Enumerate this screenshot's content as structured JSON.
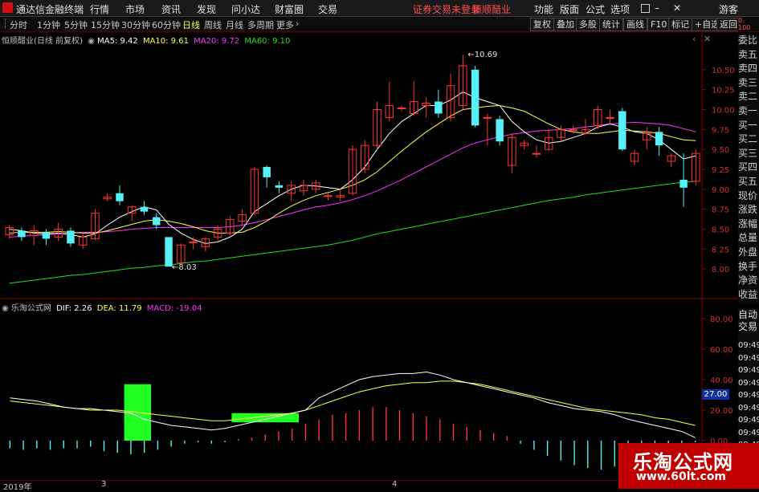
{
  "app": {
    "title": "通达信金融终端",
    "logo_icon": "app-logo-icon"
  },
  "menu": [
    {
      "label": "行情"
    },
    {
      "label": "市场"
    },
    {
      "label": "资讯"
    },
    {
      "label": "发现"
    },
    {
      "label": "问小达"
    },
    {
      "label": "财富圈"
    },
    {
      "label": "交易"
    }
  ],
  "notice": {
    "login": "证券交易未登录",
    "stock": "恒顺醋业"
  },
  "menu_right": [
    {
      "label": "功能"
    },
    {
      "label": "版面"
    },
    {
      "label": "公式"
    },
    {
      "label": "选项"
    }
  ],
  "guest": "游客",
  "periods": [
    {
      "label": "分时"
    },
    {
      "label": "1分钟"
    },
    {
      "label": "5分钟"
    },
    {
      "label": "15分钟"
    },
    {
      "label": "30分钟"
    },
    {
      "label": "60分钟"
    },
    {
      "label": "日线"
    },
    {
      "label": "周线"
    },
    {
      "label": "月线"
    },
    {
      "label": "多周期"
    },
    {
      "label": "更多"
    }
  ],
  "tools": [
    {
      "label": "复权"
    },
    {
      "label": "叠加"
    },
    {
      "label": "多股"
    },
    {
      "label": "统计"
    },
    {
      "label": "画线"
    },
    {
      "label": "F10"
    },
    {
      "label": "标记"
    },
    {
      "label": "+自选"
    },
    {
      "label": "返回"
    }
  ],
  "price_panel": {
    "title": "恒顺醋业(日线 前复权)",
    "ma": [
      {
        "label": "MA5: 9.42",
        "color": "#ffffff"
      },
      {
        "label": "MA10: 9.61",
        "color": "#ffff4a"
      },
      {
        "label": "MA20: 9.72",
        "color": "#ff33ff"
      },
      {
        "label": "MA60: 9.10",
        "color": "#22dd22"
      }
    ],
    "yticks": [
      "10.50",
      "10.25",
      "10.00",
      "9.75",
      "9.50",
      "9.25",
      "9.00",
      "8.75",
      "8.50",
      "8.25",
      "8.00"
    ],
    "high_label": "10.69",
    "low_label": "8.03"
  },
  "indicator_panel": {
    "title": "乐淘公式网",
    "dif": "DIF: 2.26",
    "dea": "DEA: 11.79",
    "macd": "MACD: -19.04",
    "yticks": [
      "80.00",
      "60.00",
      "40.00",
      "20.00",
      "0.00"
    ],
    "cursor_value": "27.00"
  },
  "dates": [
    "2019年",
    "3",
    "4"
  ],
  "right_panel": {
    "items": [
      "委比",
      "卖五",
      "卖四",
      "卖三",
      "卖二",
      "卖一",
      "买一",
      "买二",
      "买三",
      "买四",
      "买五",
      "现价",
      "涨跌",
      "涨幅",
      "总量",
      "外盘",
      "换手",
      "净资",
      "收益"
    ],
    "auto_trade": [
      "自动",
      "交易"
    ],
    "times": [
      "09:49",
      "09:49",
      "09:49",
      "09:49",
      "09:49",
      "09:49",
      "09:49",
      "09:49",
      "09:49"
    ],
    "top_mark": [
      "0.",
      "100"
    ]
  },
  "watermark": {
    "name": "乐淘公式网",
    "url": "www.60lt.com"
  },
  "colors": {
    "up": "#ff3333",
    "down": "#55f0f8",
    "ma5": "#ffffff",
    "ma10": "#ffff4a",
    "ma20": "#ff33ff",
    "ma60": "#22dd22",
    "macd_up": "#ff3333",
    "macd_down": "#55f0f8",
    "green_bar": "#22ff22"
  },
  "chart_data": [
    {
      "type": "candlestick",
      "title": "恒顺醋业(日线 前复权)",
      "ylim": [
        7.8,
        10.75
      ],
      "candles": [
        {
          "o": 8.43,
          "c": 8.52,
          "h": 8.55,
          "l": 8.38
        },
        {
          "o": 8.48,
          "c": 8.4,
          "h": 8.52,
          "l": 8.35
        },
        {
          "o": 8.42,
          "c": 8.48,
          "h": 8.55,
          "l": 8.3
        },
        {
          "o": 8.46,
          "c": 8.38,
          "h": 8.5,
          "l": 8.3
        },
        {
          "o": 8.4,
          "c": 8.5,
          "h": 8.58,
          "l": 8.35
        },
        {
          "o": 8.48,
          "c": 8.32,
          "h": 8.52,
          "l": 8.28
        },
        {
          "o": 8.3,
          "c": 8.4,
          "h": 8.45,
          "l": 8.25
        },
        {
          "o": 8.38,
          "c": 8.7,
          "h": 8.75,
          "l": 8.36
        },
        {
          "o": 8.88,
          "c": 8.9,
          "h": 8.95,
          "l": 8.85
        },
        {
          "o": 8.95,
          "c": 8.85,
          "h": 9.05,
          "l": 8.8
        },
        {
          "o": 8.7,
          "c": 8.78,
          "h": 8.8,
          "l": 8.6
        },
        {
          "o": 8.78,
          "c": 8.72,
          "h": 8.85,
          "l": 8.68
        },
        {
          "o": 8.65,
          "c": 8.55,
          "h": 8.7,
          "l": 8.5
        },
        {
          "o": 8.4,
          "c": 8.03,
          "h": 8.4,
          "l": 8.03
        },
        {
          "o": 8.08,
          "c": 8.3,
          "h": 8.32,
          "l": 8.05
        },
        {
          "o": 8.34,
          "c": 8.34,
          "h": 8.4,
          "l": 8.25
        },
        {
          "o": 8.28,
          "c": 8.38,
          "h": 8.4,
          "l": 8.22
        },
        {
          "o": 8.4,
          "c": 8.5,
          "h": 8.55,
          "l": 8.36
        },
        {
          "o": 8.45,
          "c": 8.62,
          "h": 8.66,
          "l": 8.42
        },
        {
          "o": 8.6,
          "c": 8.68,
          "h": 8.75,
          "l": 8.55
        },
        {
          "o": 8.7,
          "c": 9.25,
          "h": 9.28,
          "l": 8.68
        },
        {
          "o": 9.28,
          "c": 9.15,
          "h": 9.3,
          "l": 9.02
        },
        {
          "o": 9.05,
          "c": 9.02,
          "h": 9.1,
          "l": 8.95
        },
        {
          "o": 8.95,
          "c": 9.05,
          "h": 9.1,
          "l": 8.85
        },
        {
          "o": 8.98,
          "c": 9.05,
          "h": 9.12,
          "l": 8.92
        },
        {
          "o": 9.0,
          "c": 9.08,
          "h": 9.12,
          "l": 8.95
        },
        {
          "o": 8.92,
          "c": 8.92,
          "h": 8.95,
          "l": 8.86
        },
        {
          "o": 8.9,
          "c": 8.92,
          "h": 9.0,
          "l": 8.85
        },
        {
          "o": 8.95,
          "c": 9.5,
          "h": 9.55,
          "l": 8.92
        },
        {
          "o": 9.25,
          "c": 9.55,
          "h": 9.62,
          "l": 9.2
        },
        {
          "o": 9.55,
          "c": 10.0,
          "h": 10.1,
          "l": 9.5
        },
        {
          "o": 9.9,
          "c": 10.05,
          "h": 10.35,
          "l": 9.85
        },
        {
          "o": 10.02,
          "c": 10.02,
          "h": 10.05,
          "l": 9.98
        },
        {
          "o": 9.95,
          "c": 10.1,
          "h": 10.35,
          "l": 9.92
        },
        {
          "o": 10.05,
          "c": 10.08,
          "h": 10.15,
          "l": 9.9
        },
        {
          "o": 10.1,
          "c": 9.95,
          "h": 10.25,
          "l": 9.9
        },
        {
          "o": 9.9,
          "c": 10.3,
          "h": 10.45,
          "l": 9.85
        },
        {
          "o": 10.05,
          "c": 10.55,
          "h": 10.69,
          "l": 10.0
        },
        {
          "o": 10.5,
          "c": 9.8,
          "h": 10.55,
          "l": 9.78
        },
        {
          "o": 9.9,
          "c": 9.9,
          "h": 9.95,
          "l": 9.55
        },
        {
          "o": 9.88,
          "c": 9.6,
          "h": 9.92,
          "l": 9.55
        },
        {
          "o": 9.3,
          "c": 9.65,
          "h": 9.7,
          "l": 9.2
        },
        {
          "o": 9.55,
          "c": 9.58,
          "h": 9.62,
          "l": 9.5
        },
        {
          "o": 9.45,
          "c": 9.45,
          "h": 9.55,
          "l": 9.4
        },
        {
          "o": 9.5,
          "c": 9.65,
          "h": 9.75,
          "l": 9.48
        },
        {
          "o": 9.65,
          "c": 9.75,
          "h": 9.8,
          "l": 9.6
        },
        {
          "o": 9.75,
          "c": 9.75,
          "h": 9.8,
          "l": 9.7
        },
        {
          "o": 9.7,
          "c": 9.75,
          "h": 9.88,
          "l": 9.68
        },
        {
          "o": 9.8,
          "c": 10.0,
          "h": 10.05,
          "l": 9.75
        },
        {
          "o": 9.9,
          "c": 9.9,
          "h": 10.0,
          "l": 9.82
        },
        {
          "o": 9.98,
          "c": 9.5,
          "h": 10.02,
          "l": 9.48
        },
        {
          "o": 9.35,
          "c": 9.45,
          "h": 9.5,
          "l": 9.3
        },
        {
          "o": 9.62,
          "c": 9.7,
          "h": 9.78,
          "l": 9.5
        },
        {
          "o": 9.72,
          "c": 9.55,
          "h": 9.78,
          "l": 9.42
        },
        {
          "o": 9.35,
          "c": 9.42,
          "h": 9.45,
          "l": 9.28
        },
        {
          "o": 9.12,
          "c": 9.02,
          "h": 9.45,
          "l": 8.78
        },
        {
          "o": 9.1,
          "c": 9.45,
          "h": 9.5,
          "l": 9.05
        }
      ],
      "ma5": [
        8.5,
        8.48,
        8.45,
        8.44,
        8.45,
        8.43,
        8.4,
        8.44,
        8.55,
        8.65,
        8.72,
        8.78,
        8.74,
        8.56,
        8.45,
        8.37,
        8.32,
        8.34,
        8.4,
        8.5,
        8.72,
        8.82,
        8.92,
        9.0,
        9.05,
        9.04,
        9.02,
        9.0,
        9.12,
        9.28,
        9.5,
        9.7,
        9.85,
        9.95,
        10.05,
        10.05,
        10.12,
        10.22,
        10.15,
        10.1,
        10.05,
        9.85,
        9.72,
        9.62,
        9.58,
        9.6,
        9.65,
        9.7,
        9.78,
        9.82,
        9.78,
        9.72,
        9.7,
        9.62,
        9.5,
        9.38,
        9.42
      ],
      "ma10": [
        8.45,
        8.46,
        8.46,
        8.46,
        8.47,
        8.46,
        8.45,
        8.45,
        8.48,
        8.52,
        8.56,
        8.6,
        8.62,
        8.6,
        8.57,
        8.53,
        8.48,
        8.45,
        8.45,
        8.46,
        8.52,
        8.6,
        8.7,
        8.79,
        8.86,
        8.92,
        8.96,
        9.0,
        9.05,
        9.12,
        9.22,
        9.35,
        9.48,
        9.6,
        9.72,
        9.82,
        9.92,
        10.0,
        10.02,
        10.04,
        10.05,
        10.02,
        9.98,
        9.9,
        9.82,
        9.75,
        9.72,
        9.7,
        9.7,
        9.72,
        9.74,
        9.73,
        9.72,
        9.7,
        9.66,
        9.62,
        9.61
      ],
      "ma20": [
        8.4,
        8.41,
        8.42,
        8.43,
        8.44,
        8.45,
        8.46,
        8.46,
        8.47,
        8.48,
        8.5,
        8.51,
        8.52,
        8.52,
        8.52,
        8.52,
        8.52,
        8.52,
        8.53,
        8.55,
        8.58,
        8.62,
        8.66,
        8.7,
        8.74,
        8.78,
        8.8,
        8.83,
        8.87,
        8.92,
        8.98,
        9.05,
        9.12,
        9.2,
        9.28,
        9.36,
        9.44,
        9.52,
        9.58,
        9.62,
        9.66,
        9.69,
        9.71,
        9.73,
        9.74,
        9.75,
        9.76,
        9.78,
        9.8,
        9.82,
        9.83,
        9.84,
        9.83,
        9.82,
        9.8,
        9.76,
        9.72
      ],
      "ma60": [
        7.82,
        7.84,
        7.86,
        7.88,
        7.9,
        7.92,
        7.93,
        7.95,
        7.97,
        7.99,
        8.01,
        8.02,
        8.04,
        8.05,
        8.07,
        8.09,
        8.1,
        8.12,
        8.14,
        8.16,
        8.18,
        8.2,
        8.22,
        8.24,
        8.26,
        8.28,
        8.3,
        8.33,
        8.36,
        8.4,
        8.44,
        8.47,
        8.5,
        8.53,
        8.56,
        8.59,
        8.62,
        8.65,
        8.68,
        8.71,
        8.74,
        8.77,
        8.8,
        8.83,
        8.86,
        8.88,
        8.9,
        8.93,
        8.95,
        8.97,
        8.99,
        9.01,
        9.03,
        9.05,
        9.07,
        9.09,
        9.1
      ]
    },
    {
      "type": "bar",
      "title": "乐淘公式网",
      "ylim": [
        -20,
        90
      ],
      "green_bars": [
        {
          "from": 9,
          "to": 10,
          "top": 37,
          "bottom": 0
        },
        {
          "from": 17,
          "to": 21,
          "top": 18,
          "bottom": 12
        }
      ],
      "vbars": [
        -5,
        -6,
        -5,
        -6,
        -5,
        -5,
        -4,
        -7,
        -8,
        -9,
        -8,
        -6,
        -4,
        -2,
        -1,
        -2,
        -1,
        1,
        2,
        4,
        6,
        8,
        11,
        14,
        17,
        18,
        20,
        22,
        22,
        20,
        18,
        16,
        14,
        11,
        9,
        7,
        5,
        3,
        -2,
        -6,
        -10,
        -13,
        -16,
        -18,
        -19,
        -17,
        -14,
        -12,
        -8,
        -5,
        -3,
        -1
      ],
      "dif": [
        28,
        27,
        26,
        24,
        22,
        21,
        21,
        20,
        19,
        18,
        14,
        12,
        10,
        9,
        8,
        7,
        8,
        10,
        12,
        14,
        16,
        18,
        20,
        28,
        32,
        36,
        40,
        42,
        43,
        44,
        44,
        45,
        43,
        40,
        38,
        36,
        34,
        32,
        30,
        28,
        25,
        23,
        21,
        20,
        19,
        17,
        14,
        12,
        10,
        8,
        6,
        2
      ],
      "dea": [
        26,
        25,
        24,
        23,
        22,
        21,
        20,
        20,
        20,
        19,
        18,
        17,
        16,
        15,
        14,
        13,
        13,
        14,
        15,
        16,
        17,
        18,
        20,
        23,
        26,
        29,
        32,
        34,
        36,
        37,
        38,
        38,
        39,
        39,
        38,
        37,
        35,
        33,
        31,
        29,
        27,
        25,
        23,
        21,
        20,
        19,
        18,
        17,
        15,
        14,
        12,
        10
      ]
    }
  ]
}
